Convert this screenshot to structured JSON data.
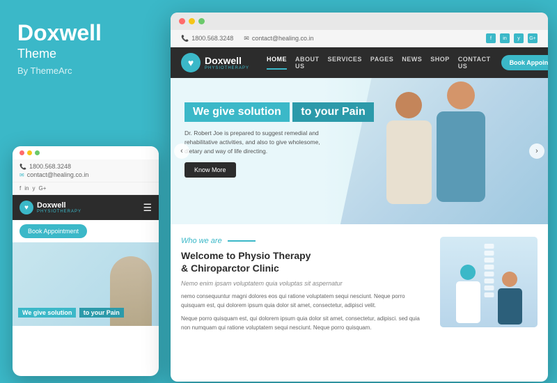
{
  "brand": {
    "title": "Doxwell",
    "subtitle": "Theme",
    "byline": "By ThemeArc",
    "logo_sub": "PHYSIOTHERAPY"
  },
  "mobile": {
    "phone": "1800.568.3248",
    "email": "contact@healing.co.in",
    "social": [
      "f",
      "in",
      "y",
      "G+"
    ],
    "book_btn": "Book Appointment",
    "hero_line1": "We give solution",
    "hero_line2": "to your Pain"
  },
  "desktop": {
    "topinfo": {
      "phone": "1800.568.3248",
      "email": "contact@healing.co.in",
      "social": [
        "f",
        "in",
        "y",
        "G+"
      ]
    },
    "nav": {
      "logo": "Doxwell",
      "logo_sub": "PHYSIOTHERAPY",
      "links": [
        "HOME",
        "ABOUT US",
        "SERVICES",
        "PAGES",
        "NEWS",
        "SHOP",
        "CONTACT US"
      ],
      "active": "HOME",
      "book_btn": "Book Appointment"
    },
    "hero": {
      "line1": "We give solution",
      "line2": "to your Pain",
      "desc": "Dr. Robert Joe is prepared to suggest remedial and rehabilitative activities, and also to give wholesome, dietary and way of life directing.",
      "know_more": "Know More"
    },
    "bottom": {
      "who_label": "Who we are",
      "heading": "Welcome to Physio Therapy\n& Chiroparctor Clinic",
      "subheading": "Nemo enim ipsam voluptatem quia voluptas sit aspernatur",
      "text1": "nemo consequuntur magni dolores eos qui ratione voluptatem sequi nesciunt. Neque porro quisquam est, qui dolorem ipsum quia dolor sit amet, consectetur, adipisci velit.",
      "text2": "Neque porro quisquam est, qui dolorem ipsum quia dolor sit amet, consectetur, adipisci. sed quia non numquam qui ratione voluptatem sequi nesciunt. Neque porro quisquam."
    }
  },
  "colors": {
    "accent": "#3bb8c8",
    "dark": "#2c2c2c",
    "light_bg": "#f5f5f5"
  }
}
